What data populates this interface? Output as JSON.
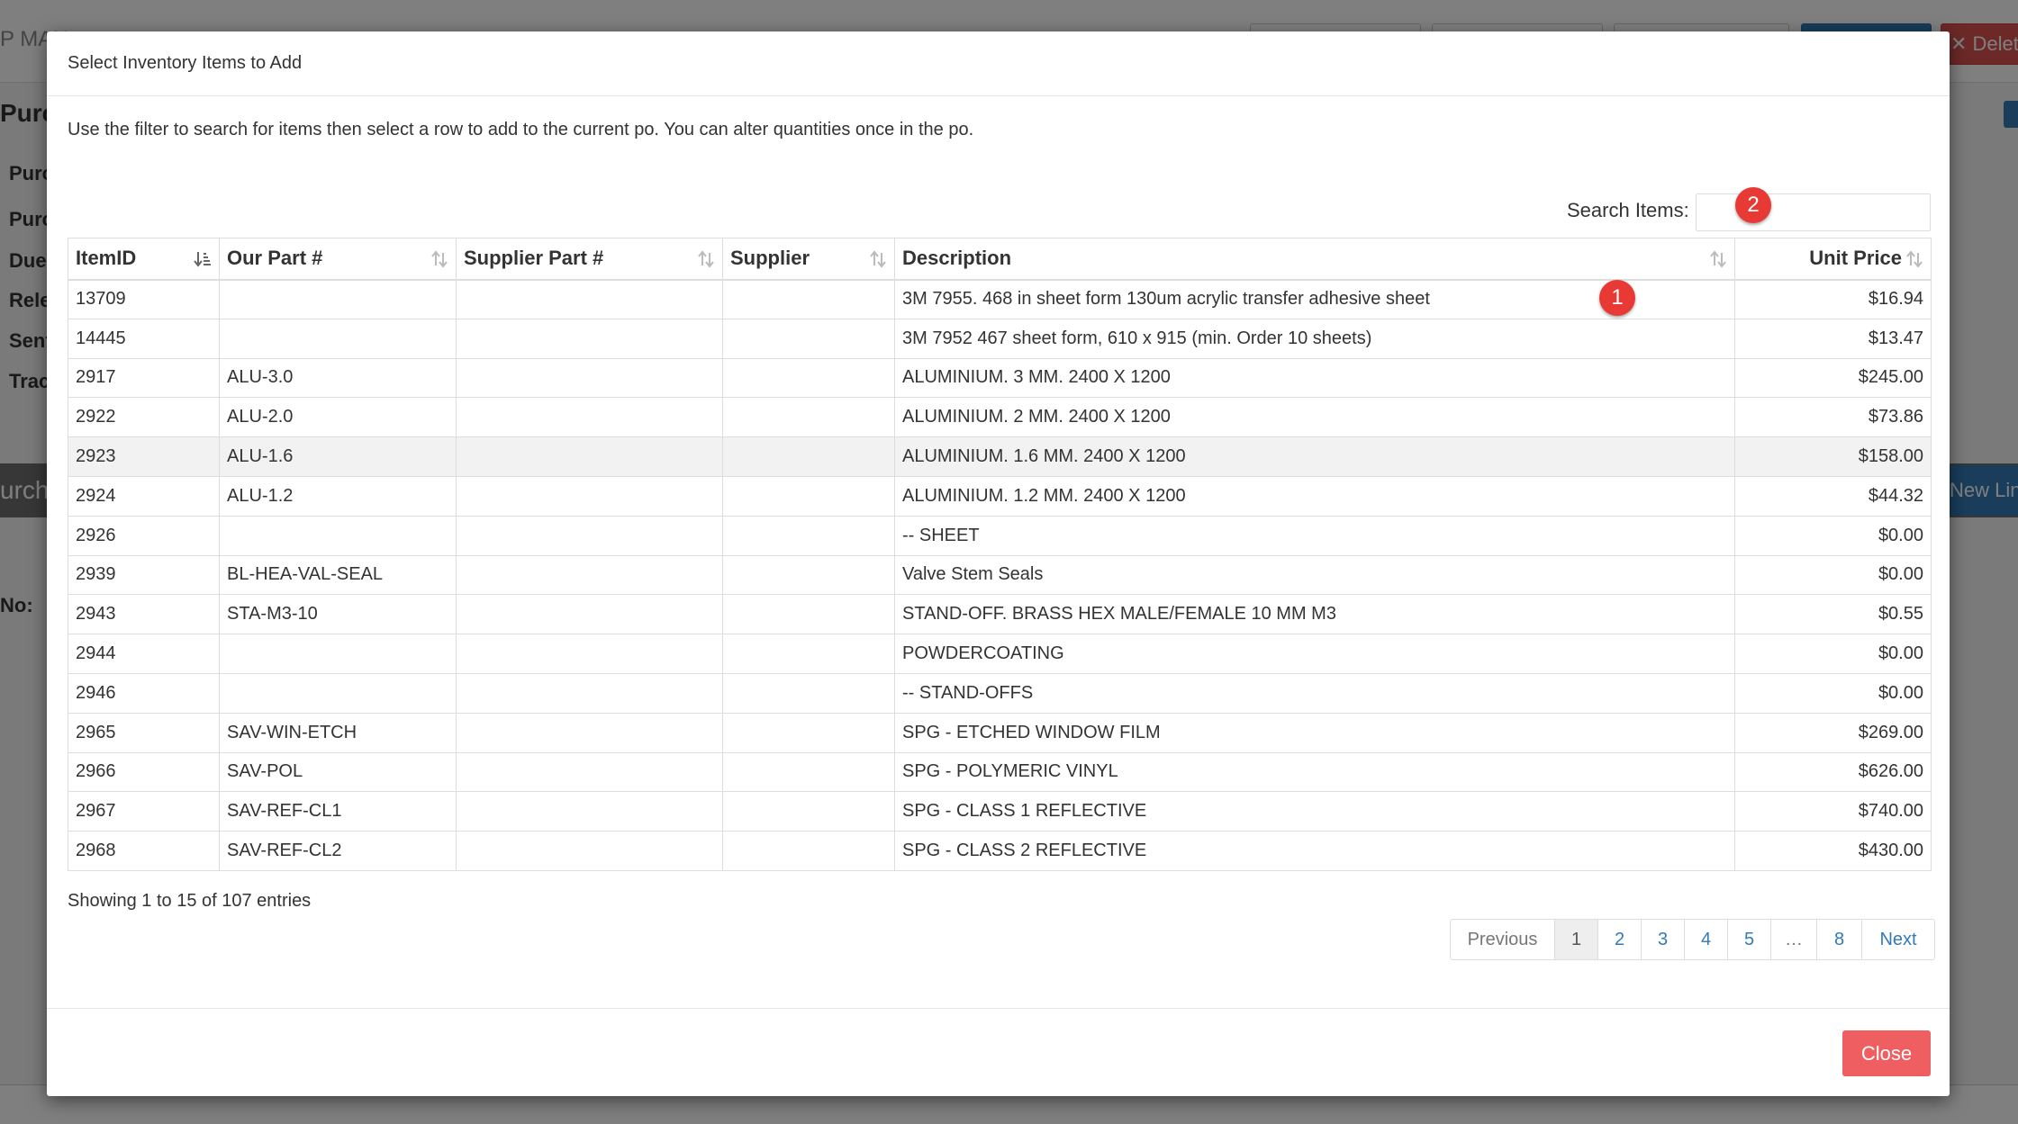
{
  "background": {
    "brand": "P MAN",
    "delete_label": "✕ Delete",
    "heading": "Purch",
    "labels": [
      "Purc",
      "Purc",
      "Due",
      "Rele",
      "Sent",
      "Trac"
    ],
    "panel_title": "urch",
    "new_line_label": "New Line",
    "no_label": "No:"
  },
  "modal": {
    "title": "Select Inventory Items to Add",
    "intro": "Use the filter to search for items then select a row to add to the current po. You can alter quantities once in the po.",
    "search": {
      "label": "Search Items:",
      "value": "",
      "placeholder": ""
    },
    "table": {
      "columns": [
        "ItemID",
        "Our Part #",
        "Supplier Part #",
        "Supplier",
        "Description",
        "Unit Price"
      ],
      "rows": [
        [
          "13709",
          "",
          "",
          "",
          "3M 7955. 468 in sheet form 130um acrylic transfer adhesive sheet",
          "$16.94"
        ],
        [
          "14445",
          "",
          "",
          "",
          "3M 7952 467 sheet form, 610 x 915 (min. Order 10 sheets)",
          "$13.47"
        ],
        [
          "2917",
          "ALU-3.0",
          "",
          "",
          "ALUMINIUM. 3 MM. 2400 X 1200",
          "$245.00"
        ],
        [
          "2922",
          "ALU-2.0",
          "",
          "",
          "ALUMINIUM. 2 MM. 2400 X 1200",
          "$73.86"
        ],
        [
          "2923",
          "ALU-1.6",
          "",
          "",
          "ALUMINIUM. 1.6 MM. 2400 X 1200",
          "$158.00"
        ],
        [
          "2924",
          "ALU-1.2",
          "",
          "",
          "ALUMINIUM. 1.2 MM. 2400 X 1200",
          "$44.32"
        ],
        [
          "2926",
          "",
          "",
          "",
          "-- SHEET",
          "$0.00"
        ],
        [
          "2939",
          "BL-HEA-VAL-SEAL",
          "",
          "",
          "Valve Stem Seals",
          "$0.00"
        ],
        [
          "2943",
          "STA-M3-10",
          "",
          "",
          "STAND-OFF. BRASS HEX MALE/FEMALE 10 MM M3",
          "$0.55"
        ],
        [
          "2944",
          "",
          "",
          "",
          "POWDERCOATING",
          "$0.00"
        ],
        [
          "2946",
          "",
          "",
          "",
          "-- STAND-OFFS",
          "$0.00"
        ],
        [
          "2965",
          "SAV-WIN-ETCH",
          "",
          "",
          "SPG - ETCHED WINDOW FILM",
          "$269.00"
        ],
        [
          "2966",
          "SAV-POL",
          "",
          "",
          "SPG - POLYMERIC VINYL",
          "$626.00"
        ],
        [
          "2967",
          "SAV-REF-CL1",
          "",
          "",
          "SPG - CLASS 1 REFLECTIVE",
          "$740.00"
        ],
        [
          "2968",
          "SAV-REF-CL2",
          "",
          "",
          "SPG - CLASS 2 REFLECTIVE",
          "$430.00"
        ]
      ]
    },
    "entries_info": "Showing 1 to 15 of 107 entries",
    "pagination": [
      "Previous",
      "1",
      "2",
      "3",
      "4",
      "5",
      "…",
      "8",
      "Next"
    ],
    "active_page": "1",
    "close_label": "Close",
    "annotations": [
      "1",
      "2"
    ]
  },
  "colors": {
    "close_button": "#ef5f61",
    "link": "#337ab7",
    "annotation_badge": "#e83935",
    "backdrop": "rgba(0,0,0,0.5)"
  }
}
